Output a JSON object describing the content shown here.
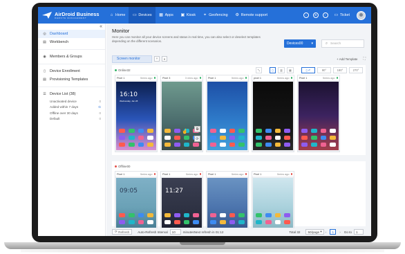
{
  "app": {
    "brand_name": "AirDroid Business",
    "brand_sub": "REMOTE MANAGEMENT"
  },
  "nav": [
    {
      "label": "Home",
      "icon": "home-icon",
      "glyph": "⌂"
    },
    {
      "label": "Devices",
      "icon": "devices-icon",
      "glyph": "▭"
    },
    {
      "label": "Apps",
      "icon": "apps-icon",
      "glyph": "▦"
    },
    {
      "label": "Kiosk",
      "icon": "kiosk-icon",
      "glyph": "▣"
    },
    {
      "label": "Geofencing",
      "icon": "geofence-icon",
      "glyph": "⌖"
    },
    {
      "label": "Remote support",
      "icon": "remote-support-icon",
      "glyph": "⚙"
    }
  ],
  "top_right": {
    "ticket_label": "Ticket"
  },
  "sidebar": {
    "items": [
      {
        "label": "Dashboard",
        "icon": "dashboard-icon",
        "glyph": "◎"
      },
      {
        "label": "Workbench",
        "icon": "workbench-icon",
        "glyph": "▤"
      },
      {
        "label": "Members & Groups",
        "icon": "members-icon",
        "glyph": "◉"
      },
      {
        "label": "Device Enrollment",
        "icon": "enrollment-icon",
        "glyph": "▯"
      },
      {
        "label": "Provisioning Templates",
        "icon": "templates-icon",
        "glyph": "▤"
      },
      {
        "label": "Device List (38)",
        "icon": "device-list-icon",
        "glyph": "☰"
      }
    ],
    "sub_items": [
      {
        "label": "Unactivated device",
        "count": "0"
      },
      {
        "label": "Added within 7 days",
        "count": "G"
      },
      {
        "label": "Offline over 30 days",
        "count": "0"
      },
      {
        "label": "Default",
        "count": "0"
      }
    ]
  },
  "monitor": {
    "title": "Monitor",
    "description": "Here you can monitor all your device screens and status in real time, you can also select or deselect templates depending on the different scenarios.",
    "devices_button": "Devices00",
    "search_placeholder": "Search",
    "tab_label": "Screen monitor",
    "add_template": "+ Add Template"
  },
  "groups": [
    {
      "label": "Online32",
      "status_color": "#35b46a",
      "rotations": [
        "90°",
        "180°",
        "270°"
      ]
    },
    {
      "label": "Offline00",
      "status_color": "#e4504a"
    }
  ],
  "devices_online": [
    {
      "name": "Pixel 1",
      "status": "5mins ago",
      "wall": "linear-gradient(#0c1f4e, #2a55b8 55%, #d88fd0)",
      "time": "16:10",
      "date": "Wednesday, Jan 28"
    },
    {
      "name": "Pixel 3",
      "status": "3 mins ago",
      "wall": "linear-gradient(#6f9a8e, #4a6b6c 60%, #3a4a48)"
    },
    {
      "name": "Pixel 1",
      "status": "5mins ago",
      "wall": "linear-gradient(#1d4fa6, #2e7ac9 55%, #43a0d9)"
    },
    {
      "name": "pixel 1",
      "status": "5mins ago",
      "wall": "linear-gradient(#0a0a0a, #171717 70%, #2a2a2a)"
    },
    {
      "name": "Pixel 1",
      "status": "5mins ago",
      "wall": "linear-gradient(#1b1230, #3c2360 50%, #a33f4c)"
    }
  ],
  "devices_offline": [
    {
      "name": "Pixel 1",
      "status": "5mins ago",
      "wall": "linear-gradient(#7fb0c6, #6aa1b6 60%, #4a7f95)",
      "time": "09:05",
      "time_dark": true
    },
    {
      "name": "Pixel 1",
      "status": "5mins ago",
      "wall": "linear-gradient(#3b3f52, #2c3041 70%, #1e2233)",
      "time": "11:27"
    },
    {
      "name": "Pixel 1",
      "status": "5mins ago",
      "wall": "linear-gradient(#6a93c2, #4c74ad 60%, #3a5a8f)"
    },
    {
      "name": "Pixel 1",
      "status": "5mins ago",
      "wall": "linear-gradient(#cfe6ee, #a9d1dc 60%, #8bb8c4)"
    }
  ],
  "footer": {
    "refresh_label": "Refresh",
    "auto_refresh_label": "Auto-Refresh Interval",
    "interval_value": "10",
    "next_refresh_text": "minutesNext refresh in 01:12",
    "total_label": "Total 32",
    "page_size": "50/page",
    "current_page": "1",
    "goto_label": "Go to",
    "goto_value": "1"
  },
  "colors": {
    "brand_blue": "#2570d9",
    "online_dot": "#35b46a",
    "offline_dot": "#e4504a"
  }
}
